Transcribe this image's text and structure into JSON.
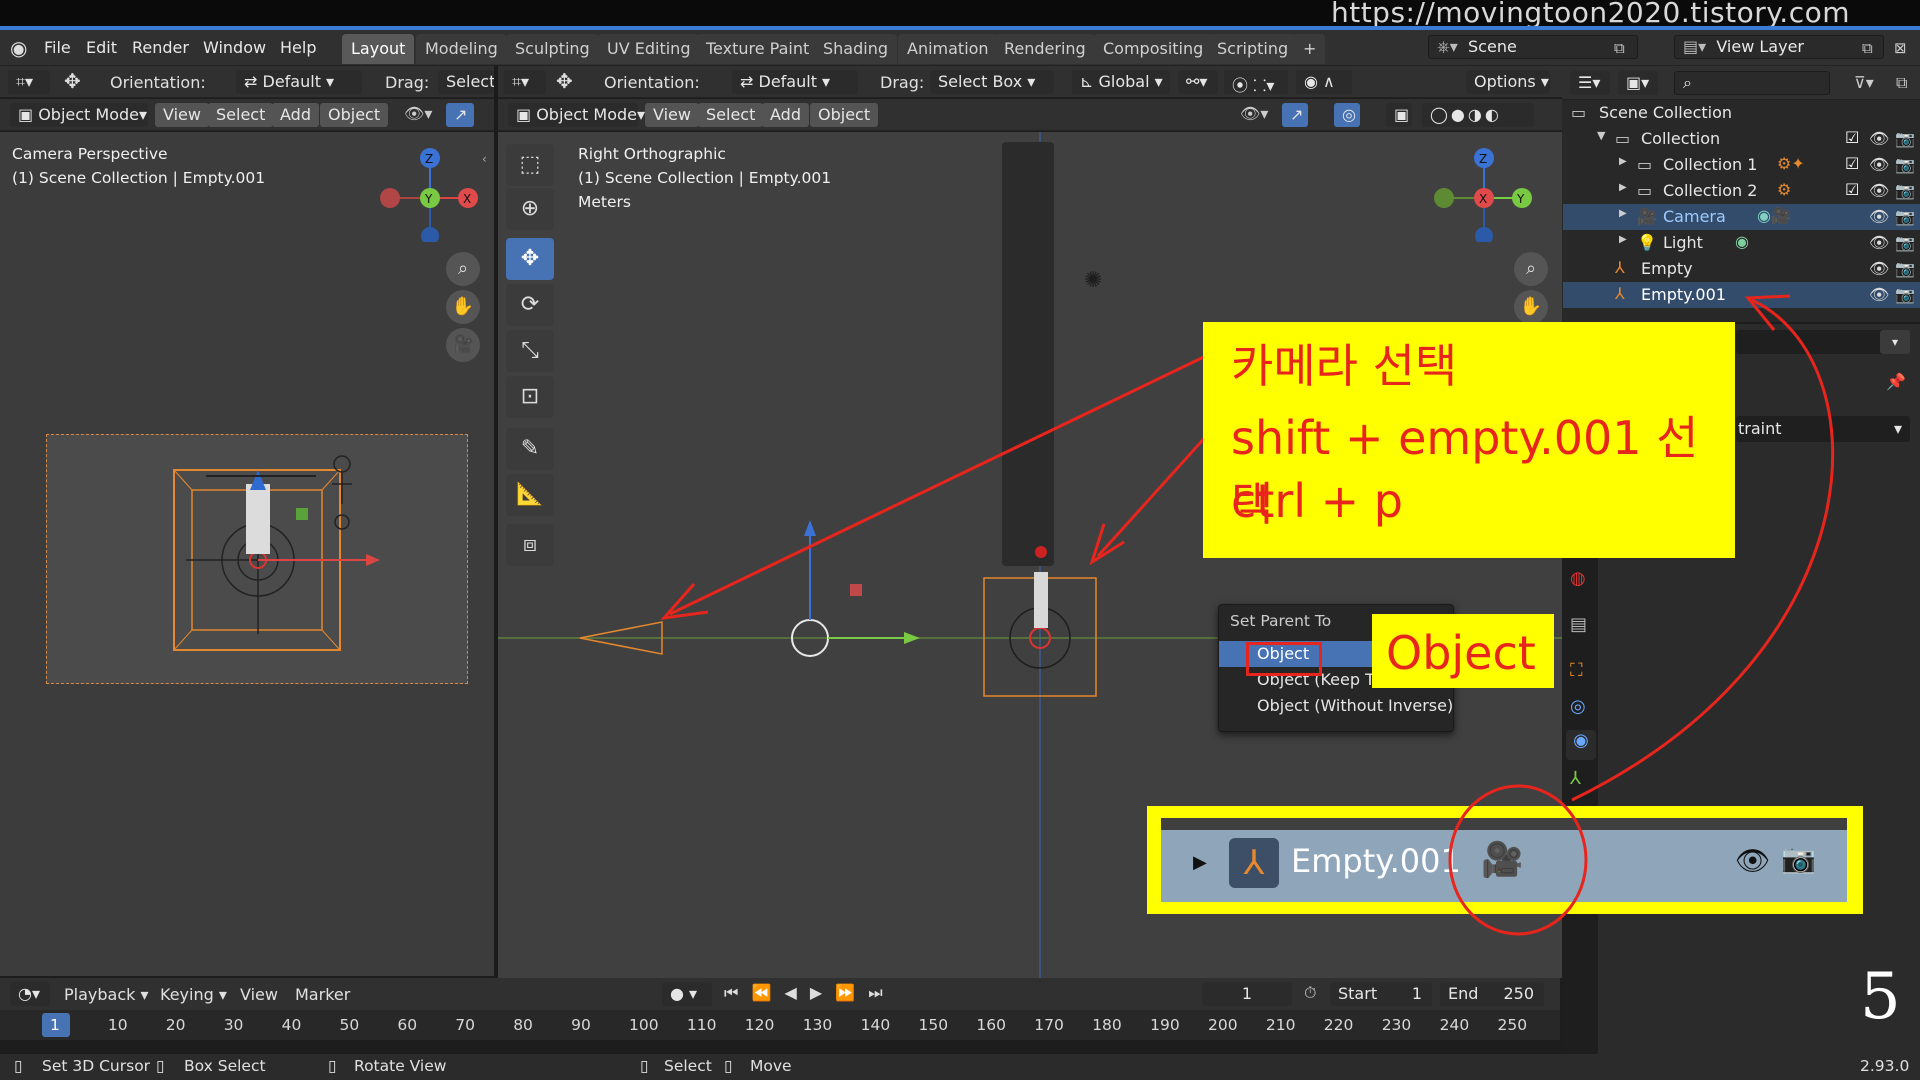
{
  "watermark_url": "https://movingtoon2020.tistory.com",
  "menu": [
    "File",
    "Edit",
    "Render",
    "Window",
    "Help"
  ],
  "workspace_tabs": [
    "Layout",
    "Modeling",
    "Sculpting",
    "UV Editing",
    "Texture Paint",
    "Shading",
    "Animation",
    "Rendering",
    "Compositing",
    "Scripting",
    "+"
  ],
  "scene": {
    "label": "Scene",
    "view_layer": "View Layer"
  },
  "left_view": {
    "orientation_label": "Orientation:",
    "orientation_value": "Default",
    "drag_label": "Drag:",
    "drag_value": "Select",
    "mode": "Object Mode",
    "menus": [
      "View",
      "Select",
      "Add",
      "Object"
    ],
    "overlay_title": "Camera Perspective",
    "overlay_sub": "(1) Scene Collection | Empty.001"
  },
  "main_view": {
    "orientation_label": "Orientation:",
    "orientation_value": "Default",
    "drag_label": "Drag:",
    "drag_value": "Select Box",
    "transform": "Global",
    "options": "Options",
    "mode": "Object Mode",
    "menus": [
      "View",
      "Select",
      "Add",
      "Object"
    ],
    "overlay_title": "Right Orthographic",
    "overlay_sub": "(1) Scene Collection | Empty.001",
    "overlay_units": "Meters"
  },
  "outliner": {
    "title": "Scene Collection",
    "rows": [
      {
        "name": "Collection",
        "indent": 0
      },
      {
        "name": "Collection 1",
        "indent": 1
      },
      {
        "name": "Collection 2",
        "indent": 1
      },
      {
        "name": "Camera",
        "indent": 1
      },
      {
        "name": "Light",
        "indent": 1
      },
      {
        "name": "Empty",
        "indent": 0
      },
      {
        "name": "Empty.001",
        "indent": 0
      }
    ]
  },
  "properties_partial": {
    "text": "traint"
  },
  "annotation": {
    "line1": "카메라 선택",
    "line2": "shift + empty.001 선택",
    "line3": "ctrl + p",
    "object_label": "Object",
    "zoom_item": "Empty.001",
    "step_number": "5"
  },
  "parent_menu": {
    "title": "Set Parent To",
    "items": [
      "Object",
      "Object (Keep Transform)",
      "Object (Without Inverse)"
    ]
  },
  "timeline": {
    "menus": [
      "Playback",
      "Keying",
      "View",
      "Marker"
    ],
    "current_frame": "1",
    "start_label": "Start",
    "start_value": "1",
    "end_label": "End",
    "end_value": "250",
    "ticks": [
      "1",
      "10",
      "20",
      "30",
      "40",
      "50",
      "60",
      "70",
      "80",
      "90",
      "100",
      "110",
      "120",
      "130",
      "140",
      "150",
      "160",
      "170",
      "180",
      "190",
      "200",
      "210",
      "220",
      "230",
      "240",
      "250"
    ]
  },
  "statusbar": {
    "items": [
      "Set 3D Cursor",
      "Box Select",
      "Rotate View",
      "Select",
      "Move"
    ],
    "version": "2.93.0"
  },
  "colors": {
    "accent": "#4772b3",
    "annotation_red": "#e8251c",
    "annotation_yellow": "#ffff00"
  }
}
